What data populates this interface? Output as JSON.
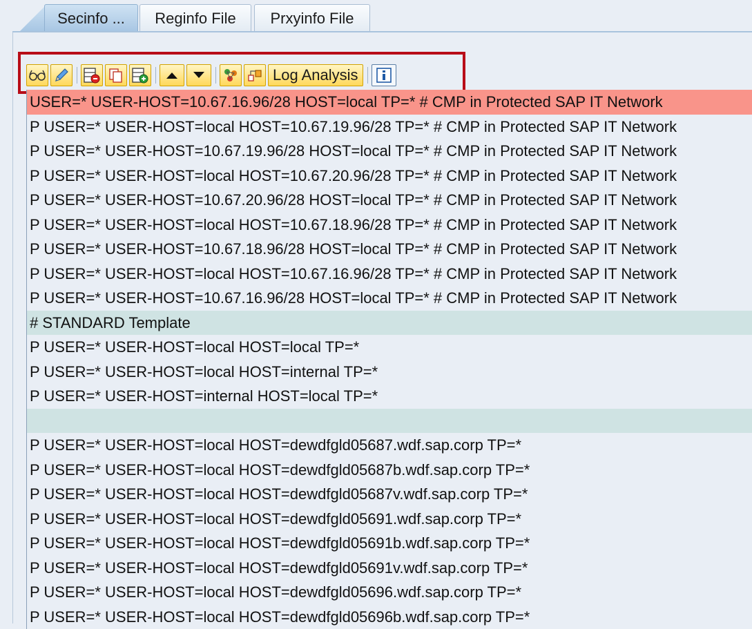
{
  "tabs": [
    {
      "label": "Secinfo ...",
      "active": true
    },
    {
      "label": "Reginfo File",
      "active": false
    },
    {
      "label": "Prxyinfo File",
      "active": false
    }
  ],
  "toolbar": {
    "buttons": [
      {
        "icon": "glasses-icon"
      },
      {
        "icon": "pencil-icon"
      },
      {
        "icon": "delete-row-icon"
      },
      {
        "icon": "copy-icon"
      },
      {
        "icon": "add-row-icon"
      },
      {
        "icon": "arrow-up-icon"
      },
      {
        "icon": "arrow-down-icon"
      },
      {
        "icon": "users-icon"
      },
      {
        "icon": "hierarchy-icon"
      }
    ],
    "log_analysis_label": "Log Analysis",
    "info_icon": "info-icon",
    "highlight_color": "#b80d18"
  },
  "colors": {
    "error_row": "#f9948a",
    "comment_row": "#cfe3e3",
    "background": "#e9eef5"
  },
  "lines": [
    {
      "text": "USER=* USER-HOST=10.67.16.96/28 HOST=local TP=* # CMP in Protected SAP IT Network",
      "type": "error"
    },
    {
      "text": "P USER=* USER-HOST=local HOST=10.67.19.96/28 TP=* # CMP in Protected SAP IT Network",
      "type": "normal"
    },
    {
      "text": "P USER=* USER-HOST=10.67.19.96/28 HOST=local TP=* # CMP in Protected SAP IT Network",
      "type": "normal"
    },
    {
      "text": "P USER=* USER-HOST=local HOST=10.67.20.96/28 TP=* # CMP in Protected SAP IT Network",
      "type": "normal"
    },
    {
      "text": "P USER=* USER-HOST=10.67.20.96/28 HOST=local TP=* # CMP in Protected SAP IT Network",
      "type": "normal"
    },
    {
      "text": "P USER=* USER-HOST=local HOST=10.67.18.96/28 TP=* # CMP in Protected SAP IT Network",
      "type": "normal"
    },
    {
      "text": "P USER=* USER-HOST=10.67.18.96/28 HOST=local TP=* # CMP in Protected SAP IT Network",
      "type": "normal"
    },
    {
      "text": "P USER=* USER-HOST=local HOST=10.67.16.96/28 TP=* # CMP in Protected SAP IT Network",
      "type": "normal"
    },
    {
      "text": "P USER=* USER-HOST=10.67.16.96/28 HOST=local TP=* # CMP in Protected SAP IT Network",
      "type": "normal"
    },
    {
      "text": "# STANDARD Template",
      "type": "comment"
    },
    {
      "text": "P USER=* USER-HOST=local HOST=local TP=*",
      "type": "normal"
    },
    {
      "text": "P USER=* USER-HOST=local HOST=internal TP=*",
      "type": "normal"
    },
    {
      "text": "P USER=* USER-HOST=internal HOST=local TP=*",
      "type": "normal"
    },
    {
      "text": "",
      "type": "empty"
    },
    {
      "text": "P USER=* USER-HOST=local HOST=dewdfgld05687.wdf.sap.corp TP=*",
      "type": "normal"
    },
    {
      "text": "P USER=* USER-HOST=local HOST=dewdfgld05687b.wdf.sap.corp TP=*",
      "type": "normal"
    },
    {
      "text": "P USER=* USER-HOST=local HOST=dewdfgld05687v.wdf.sap.corp TP=*",
      "type": "normal"
    },
    {
      "text": "P USER=* USER-HOST=local HOST=dewdfgld05691.wdf.sap.corp TP=*",
      "type": "normal"
    },
    {
      "text": "P USER=* USER-HOST=local HOST=dewdfgld05691b.wdf.sap.corp TP=*",
      "type": "normal"
    },
    {
      "text": "P USER=* USER-HOST=local HOST=dewdfgld05691v.wdf.sap.corp TP=*",
      "type": "normal"
    },
    {
      "text": "P USER=* USER-HOST=local HOST=dewdfgld05696.wdf.sap.corp TP=*",
      "type": "normal"
    },
    {
      "text": "P USER=* USER-HOST=local HOST=dewdfgld05696b.wdf.sap.corp TP=*",
      "type": "normal"
    }
  ]
}
